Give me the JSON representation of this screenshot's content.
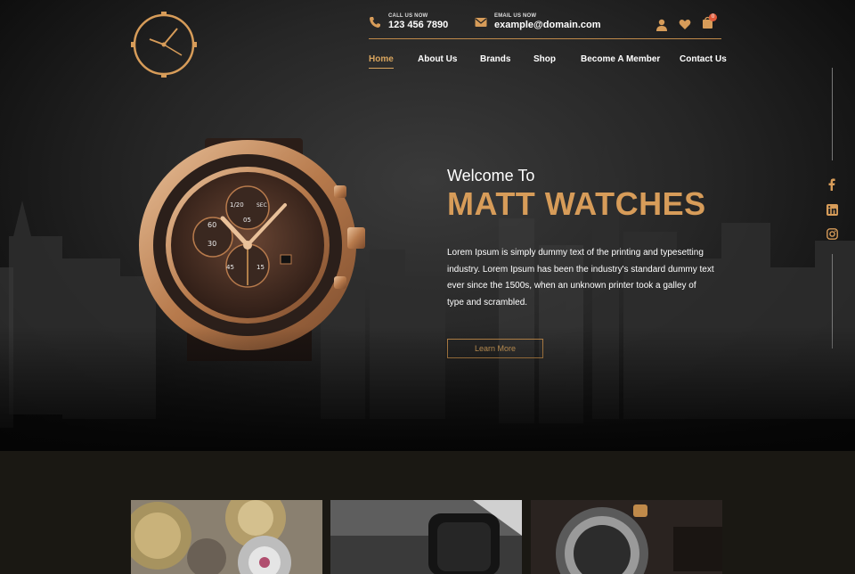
{
  "colors": {
    "accent": "#d79c59",
    "bg_dark": "#050505",
    "bottom_bg": "#1a1813"
  },
  "header": {
    "logo_icon": "clock-logo-icon",
    "call": {
      "label": "CALL US NOW",
      "value": "123 456 7890",
      "icon": "phone-icon"
    },
    "email": {
      "label": "EMAIL US NOW",
      "value": "example@domain.com",
      "icon": "envelope-icon"
    },
    "icons": {
      "user": "user-icon",
      "wishlist": "heart-icon",
      "cart": "cart-icon",
      "cart_count": "0"
    }
  },
  "nav": {
    "items": [
      {
        "label": "Home",
        "active": true
      },
      {
        "label": "About Us"
      },
      {
        "label": "Brands"
      },
      {
        "label": "Shop"
      },
      {
        "label": "Become A Member"
      },
      {
        "label": "Contact Us"
      }
    ]
  },
  "hero": {
    "welcome": "Welcome To",
    "title": "MATT WATCHES",
    "text": "Lorem Ipsum is simply dummy text of the printing and typesetting industry. Lorem Ipsum has been the industry's standard dummy text ever since the 1500s, when an unknown printer took a galley of type and scrambled.",
    "button": "Learn More",
    "image": "chronograph-watch-image",
    "watch_markings": {
      "sub1": "1/20",
      "sub2": "SEC",
      "n60": "60",
      "n30": "30",
      "n05": "05",
      "n45": "45",
      "n15": "15"
    }
  },
  "social": [
    "facebook-icon",
    "linkedin-icon",
    "instagram-icon"
  ],
  "gallery": [
    "watch-gears-image",
    "black-watch-image",
    "steel-watch-image"
  ]
}
